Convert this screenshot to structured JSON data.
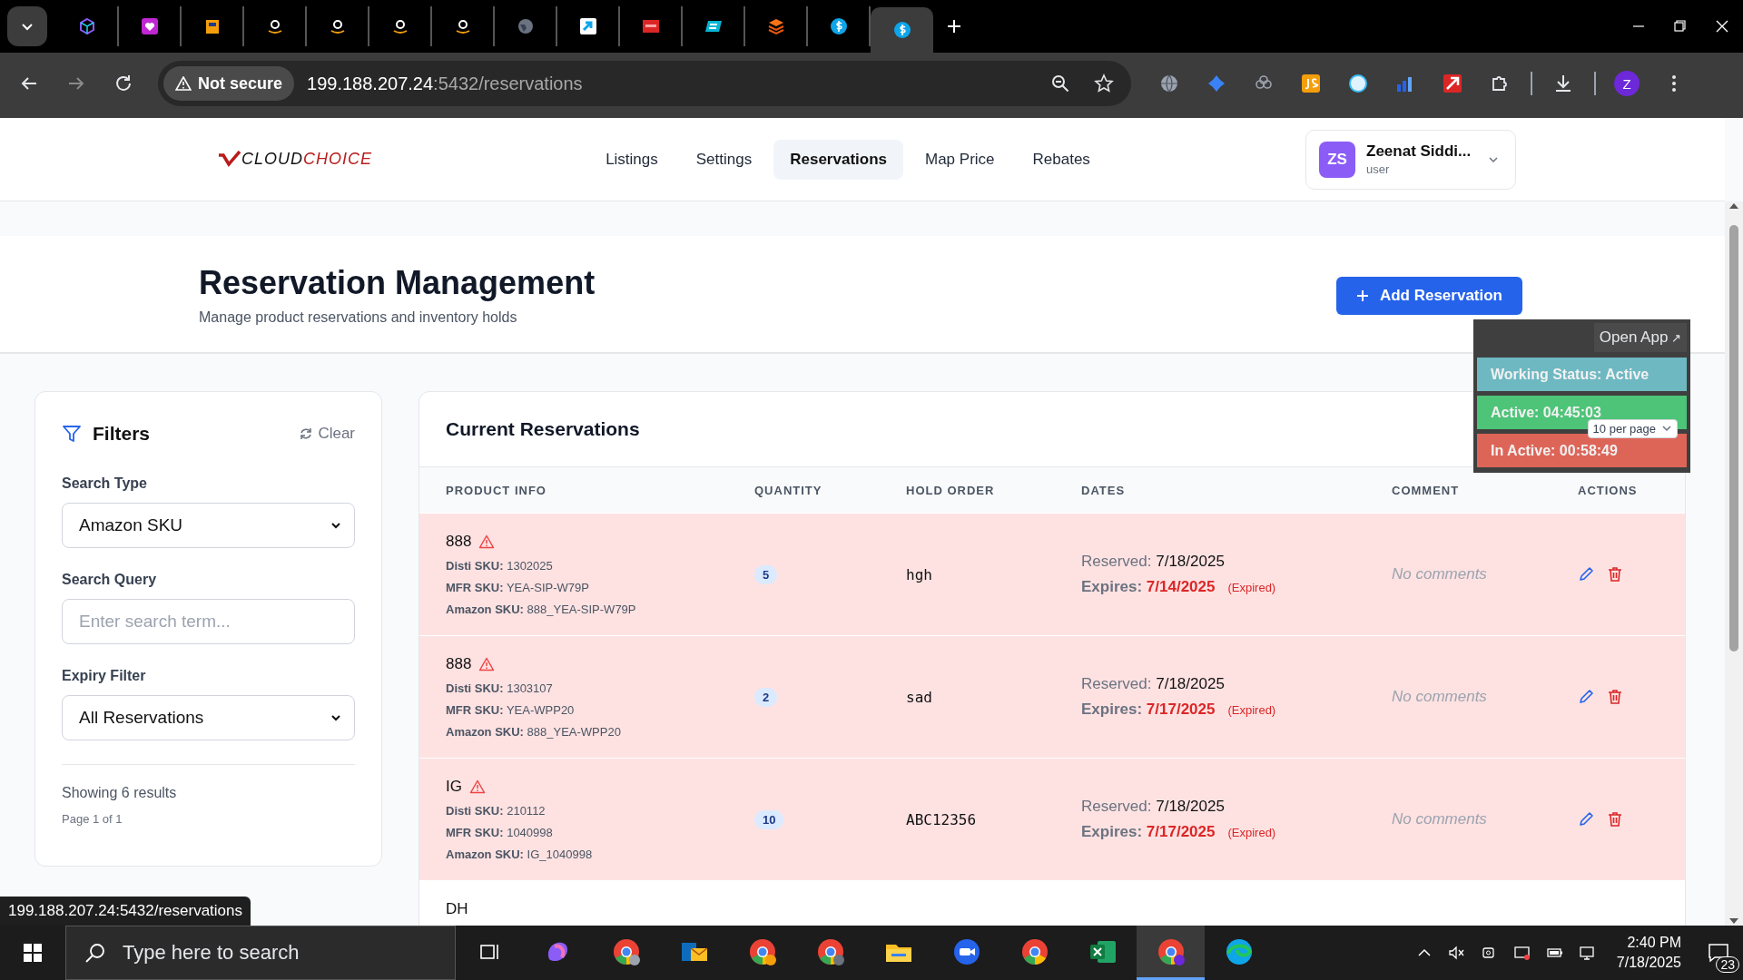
{
  "browser": {
    "tabs": [
      {
        "selected": false
      },
      {
        "selected": false
      },
      {
        "selected": false
      },
      {
        "selected": false
      },
      {
        "selected": false
      },
      {
        "selected": false
      },
      {
        "selected": false
      },
      {
        "selected": false
      },
      {
        "selected": false
      },
      {
        "selected": false
      },
      {
        "selected": false
      },
      {
        "selected": false
      },
      {
        "selected": false
      },
      {
        "selected": true
      }
    ],
    "address": {
      "security": "Not secure",
      "host": "199.188.207.24",
      "path": ":5432/reservations"
    },
    "profile_initial": "Z"
  },
  "app": {
    "logo": {
      "part_1": "CLOUD",
      "part_2": "CHOICE"
    },
    "nav": [
      {
        "label": "Listings",
        "selected": false
      },
      {
        "label": "Settings",
        "selected": false
      },
      {
        "label": "Reservations",
        "selected": true
      },
      {
        "label": "Map Price",
        "selected": false
      },
      {
        "label": "Rebates",
        "selected": false
      }
    ],
    "user": {
      "initials": "ZS",
      "name": "Zeenat Siddi...",
      "role": "user"
    }
  },
  "page": {
    "title": "Reservation Management",
    "subtitle": "Manage product reservations and inventory holds",
    "add_button": "Add Reservation"
  },
  "filters": {
    "title": "Filters",
    "clear": "Clear",
    "fields": [
      {
        "kind": "select",
        "label": "Search Type",
        "value": "Amazon SKU"
      },
      {
        "kind": "input",
        "label": "Search Query",
        "placeholder": "Enter search term..."
      },
      {
        "kind": "select",
        "label": "Expiry Filter",
        "value": "All Reservations"
      }
    ],
    "summary": "Showing 6 results",
    "page": "Page 1 of 1"
  },
  "reservations": {
    "title": "Current Reservations",
    "page_size": "10 per page",
    "columns": [
      "PRODUCT INFO",
      "QUANTITY",
      "HOLD ORDER",
      "DATES",
      "COMMENT",
      "ACTIONS"
    ],
    "rows": [
      {
        "product": "888",
        "expired": true,
        "details": [
          {
            "label": "Disti SKU:",
            "value": "1302025"
          },
          {
            "label": "MFR SKU:",
            "value": "YEA-SIP-W79P"
          },
          {
            "label": "Amazon SKU:",
            "value": "888_YEA-SIP-W79P"
          }
        ],
        "quantity": "5",
        "hold_order": "hgh",
        "reserved_label": "Reserved:",
        "reserved": "7/18/2025",
        "expires_label": "Expires:",
        "expires": "7/14/2025",
        "expired_tag": "(Expired)",
        "comment": "No comments"
      },
      {
        "product": "888",
        "expired": true,
        "details": [
          {
            "label": "Disti SKU:",
            "value": "1303107"
          },
          {
            "label": "MFR SKU:",
            "value": "YEA-WPP20"
          },
          {
            "label": "Amazon SKU:",
            "value": "888_YEA-WPP20"
          }
        ],
        "quantity": "2",
        "hold_order": "sad",
        "reserved_label": "Reserved:",
        "reserved": "7/18/2025",
        "expires_label": "Expires:",
        "expires": "7/17/2025",
        "expired_tag": "(Expired)",
        "comment": "No comments"
      },
      {
        "product": "IG",
        "expired": true,
        "details": [
          {
            "label": "Disti SKU:",
            "value": "210112"
          },
          {
            "label": "MFR SKU:",
            "value": "1040998"
          },
          {
            "label": "Amazon SKU:",
            "value": "IG_1040998"
          }
        ],
        "quantity": "10",
        "hold_order": "ABC12356",
        "reserved_label": "Reserved:",
        "reserved": "7/18/2025",
        "expires_label": "Expires:",
        "expires": "7/17/2025",
        "expired_tag": "(Expired)",
        "comment": "No comments"
      },
      {
        "product": "DH",
        "expired": false
      }
    ]
  },
  "status_widget": {
    "open_app": "Open App",
    "open_icon": "↗",
    "items": [
      {
        "label": "Working Status: Active",
        "color": "#72c2cc"
      },
      {
        "label": "Active: 04:45:03",
        "color": "#4fcf7d"
      },
      {
        "label": "In Active: 00:58:49",
        "color": "#e9685a"
      }
    ]
  },
  "link_preview": "199.188.207.24:5432/reservations",
  "taskbar": {
    "search_placeholder": "Type here to search",
    "apps": [
      {
        "selected": false
      },
      {
        "selected": false
      },
      {
        "selected": false
      },
      {
        "selected": false
      },
      {
        "selected": false
      },
      {
        "selected": false
      },
      {
        "selected": false
      },
      {
        "selected": false
      },
      {
        "selected": false
      },
      {
        "selected": true
      },
      {
        "selected": false
      }
    ],
    "time": "2:40 PM",
    "date": "7/18/2025",
    "notifications": "23"
  }
}
